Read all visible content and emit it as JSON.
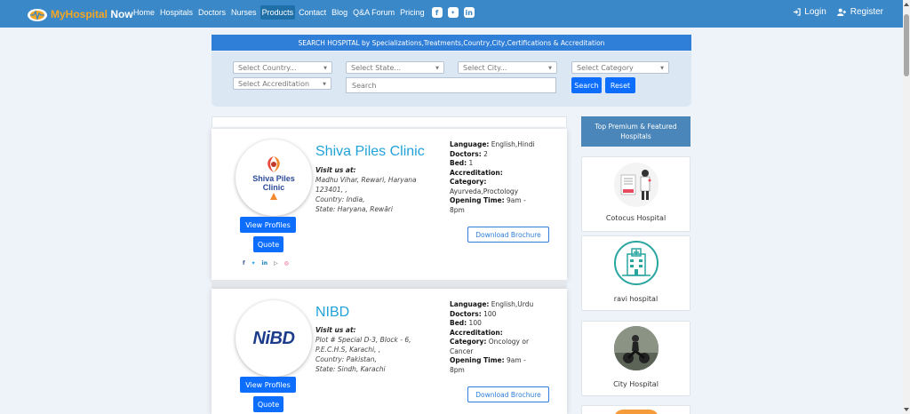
{
  "brand": {
    "part1": "MyHospital",
    "part2": " Now"
  },
  "nav": {
    "links": [
      "Home",
      "Hospitals",
      "Doctors",
      "Nurses",
      "Products",
      "Contact",
      "Blog",
      "Q&A Forum",
      "Pricing"
    ],
    "active": "Products",
    "social": [
      "f",
      "t",
      "in"
    ],
    "login": "Login",
    "register": "Register"
  },
  "search": {
    "header": "SEARCH HOSPITAL by Specializations,Treatments,Country,City,Certifications & Accreditation",
    "country_placeholder": "Select Country...",
    "state_placeholder": "Select State...",
    "city_placeholder": "Select City...",
    "category_placeholder": "Select Category",
    "accreditation_placeholder": "Select Accreditation",
    "search_placeholder": "Search",
    "search_button": "Search",
    "reset_button": "Reset"
  },
  "hospitals": [
    {
      "name": "Shiva Piles Clinic",
      "logo_text": [
        "Shiva Piles",
        "Clinic"
      ],
      "visit_label": "Visit us at:",
      "address": "Madhu Vihar, Rewari, Haryana 123401, ,",
      "country": "Country: India,",
      "state": "State: Haryana, Rewāri",
      "language_label": "Language:",
      "language": " English,Hindi",
      "doctors_label": "Doctors:",
      "doctors": " 2",
      "bed_label": "Bed:",
      "bed": " 1",
      "accreditation_label": "Accreditation:",
      "category_label": "Category:",
      "category": "Ayurveda,Proctology",
      "opening_label": "Opening Time:",
      "opening": " 9am - 8pm",
      "view_profiles": "View Profiles",
      "quote": "Quote",
      "brochure": "Download Brochure",
      "social": [
        "f",
        "t",
        "in",
        "yt",
        "ig"
      ]
    },
    {
      "name": "NIBD",
      "logo_text": [
        "NiBD"
      ],
      "visit_label": "Visit us at:",
      "address": "Plot # Special D-3, Block - 6, P.E.C.H.S, Karachi, ,",
      "country": "Country: Pakistan,",
      "state": "State: Sindh, Karachi",
      "language_label": "Language:",
      "language": " English,Urdu",
      "doctors_label": "Doctors:",
      "doctors": " 100",
      "bed_label": "Bed:",
      "bed": " 100",
      "accreditation_label": "Accreditation:",
      "category_label": "Category:",
      "category": " Oncology or Cancer",
      "opening_label": "Opening Time:",
      "opening": " 9am - 8pm",
      "view_profiles": "View Profiles",
      "quote": "Quote",
      "brochure": "Download Brochure"
    }
  ],
  "sidebar": {
    "title": "Top Premium & Featured Hospitals",
    "items": [
      {
        "name": "Cotocus Hospital",
        "icon": "doctor-illustration"
      },
      {
        "name": "ravi hospital",
        "icon": "hospital-building-icon"
      },
      {
        "name": "City Hospital",
        "icon": "motorcycle-photo"
      }
    ]
  },
  "colors": {
    "navbar": "#3a88c8",
    "accent": "#0d6efd",
    "hospital_name": "#21a2d9",
    "sidebar_head": "#4a86b9"
  }
}
